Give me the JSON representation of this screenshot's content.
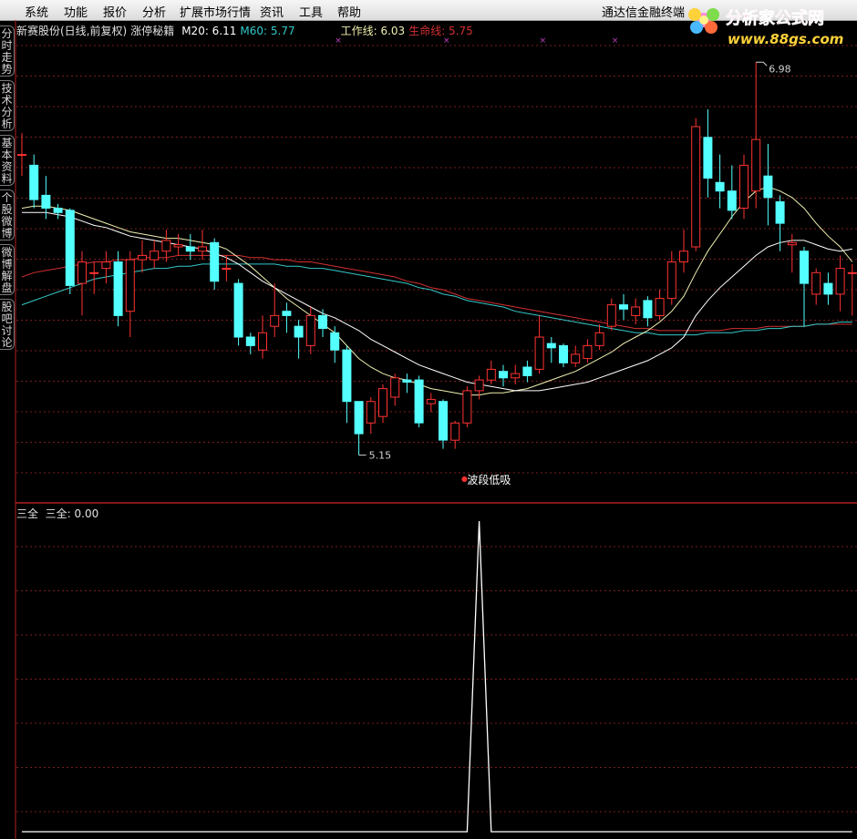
{
  "menu": [
    "系统",
    "功能",
    "报价",
    "分析",
    "扩展市场行情",
    "资讯",
    "工具",
    "帮助"
  ],
  "app_name": "通达信金融终端",
  "logo": {
    "title": "分析家公式网",
    "url": "www.88gs.com"
  },
  "side_tabs": [
    "分时走势",
    "技术分析",
    "基本资料",
    "个股微博",
    "微博解盘",
    "股吧讨论"
  ],
  "main_header": {
    "stock": "新赛股份(日线,前复权)",
    "indicator": "涨停秘籍",
    "m20": "M20: 6.11",
    "m60": "M60: 5.77",
    "work_line": "工作线: 6.03",
    "life_line": "生命线: 5.75"
  },
  "annotations": {
    "high_label": "6.98",
    "low_label": "5.15",
    "signal_label": "波段低吸"
  },
  "sub_header": {
    "name": "三全",
    "value_label": "三全: 0.00"
  },
  "colors": {
    "up": "#ff3232",
    "down": "#54ffff",
    "m20": "#ffffff",
    "m60": "#35c8c8",
    "work": "#f0f0b0",
    "life": "#d23030",
    "grid": "#7a1e1e",
    "signal": "#ffffff"
  },
  "chart_data": [
    {
      "type": "candlestick",
      "title": "新赛股份(日线,前复权)",
      "ylim": [
        5.0,
        7.1
      ],
      "candles": [
        [
          6.55,
          6.55,
          6.65,
          6.45
        ],
        [
          6.5,
          6.34,
          6.55,
          6.3
        ],
        [
          6.36,
          6.3,
          6.45,
          6.25
        ],
        [
          6.3,
          6.28,
          6.32,
          6.25
        ],
        [
          6.29,
          5.94,
          6.3,
          5.9
        ],
        [
          5.95,
          6.05,
          6.1,
          5.8
        ],
        [
          6.0,
          6.0,
          6.05,
          5.9
        ],
        [
          6.02,
          6.05,
          6.1,
          5.95
        ],
        [
          6.05,
          5.8,
          6.1,
          5.75
        ],
        [
          5.82,
          6.06,
          6.1,
          5.7
        ],
        [
          6.06,
          6.08,
          6.15,
          6.0
        ],
        [
          6.06,
          6.1,
          6.15,
          6.02
        ],
        [
          6.1,
          6.15,
          6.2,
          6.05
        ],
        [
          6.12,
          6.13,
          6.18,
          6.08
        ],
        [
          6.12,
          6.1,
          6.18,
          6.06
        ],
        [
          6.1,
          6.12,
          6.2,
          6.06
        ],
        [
          6.14,
          5.96,
          6.16,
          5.92
        ],
        [
          6.02,
          6.02,
          6.08,
          5.96
        ],
        [
          5.95,
          5.7,
          5.97,
          5.66
        ],
        [
          5.7,
          5.66,
          5.72,
          5.62
        ],
        [
          5.64,
          5.72,
          5.8,
          5.6
        ],
        [
          5.75,
          5.8,
          5.95,
          5.7
        ],
        [
          5.82,
          5.8,
          5.86,
          5.72
        ],
        [
          5.75,
          5.7,
          5.78,
          5.6
        ],
        [
          5.66,
          5.8,
          5.84,
          5.62
        ],
        [
          5.8,
          5.74,
          5.83,
          5.7
        ],
        [
          5.72,
          5.64,
          5.75,
          5.58
        ],
        [
          5.64,
          5.4,
          5.66,
          5.3
        ],
        [
          5.4,
          5.25,
          5.4,
          5.15
        ],
        [
          5.3,
          5.4,
          5.42,
          5.25
        ],
        [
          5.33,
          5.46,
          5.48,
          5.3
        ],
        [
          5.42,
          5.51,
          5.53,
          5.38
        ],
        [
          5.5,
          5.49,
          5.53,
          5.44
        ],
        [
          5.5,
          5.3,
          5.52,
          5.28
        ],
        [
          5.39,
          5.41,
          5.44,
          5.35
        ],
        [
          5.4,
          5.22,
          5.41,
          5.18
        ],
        [
          5.22,
          5.3,
          5.31,
          5.18
        ],
        [
          5.3,
          5.45,
          5.47,
          5.28
        ],
        [
          5.45,
          5.5,
          5.52,
          5.41
        ],
        [
          5.5,
          5.55,
          5.59,
          5.48
        ],
        [
          5.54,
          5.51,
          5.57,
          5.47
        ],
        [
          5.51,
          5.53,
          5.57,
          5.48
        ],
        [
          5.56,
          5.52,
          5.59,
          5.49
        ],
        [
          5.55,
          5.7,
          5.8,
          5.53
        ],
        [
          5.67,
          5.65,
          5.7,
          5.58
        ],
        [
          5.66,
          5.58,
          5.67,
          5.56
        ],
        [
          5.58,
          5.62,
          5.66,
          5.56
        ],
        [
          5.6,
          5.66,
          5.69,
          5.58
        ],
        [
          5.66,
          5.72,
          5.76,
          5.64
        ],
        [
          5.75,
          5.85,
          5.88,
          5.73
        ],
        [
          5.85,
          5.83,
          5.9,
          5.78
        ],
        [
          5.8,
          5.84,
          5.88,
          5.76
        ],
        [
          5.87,
          5.79,
          5.89,
          5.75
        ],
        [
          5.8,
          5.88,
          5.92,
          5.78
        ],
        [
          5.88,
          6.05,
          6.1,
          5.85
        ],
        [
          6.05,
          6.1,
          6.2,
          6.0
        ],
        [
          6.12,
          6.68,
          6.72,
          6.1
        ],
        [
          6.63,
          6.44,
          6.76,
          6.35
        ],
        [
          6.42,
          6.38,
          6.55,
          6.3
        ],
        [
          6.38,
          6.29,
          6.5,
          6.25
        ],
        [
          6.3,
          6.5,
          6.55,
          6.25
        ],
        [
          6.38,
          6.62,
          6.98,
          6.3
        ],
        [
          6.45,
          6.35,
          6.6,
          6.22
        ],
        [
          6.33,
          6.23,
          6.36,
          6.1
        ],
        [
          6.13,
          6.14,
          6.18,
          6.0
        ],
        [
          6.1,
          5.95,
          6.12,
          5.75
        ],
        [
          5.9,
          6.0,
          6.02,
          5.85
        ],
        [
          5.95,
          5.9,
          6.0,
          5.85
        ],
        [
          5.9,
          6.02,
          6.08,
          5.82
        ],
        [
          6.0,
          6.0,
          6.04,
          5.8
        ]
      ],
      "m20": [
        6.28,
        6.28,
        6.28,
        6.27,
        6.26,
        6.24,
        6.22,
        6.21,
        6.19,
        6.17,
        6.16,
        6.15,
        6.14,
        6.13,
        6.12,
        6.11,
        6.09,
        6.07,
        6.04,
        6.0,
        5.96,
        5.93,
        5.9,
        5.87,
        5.84,
        5.81,
        5.79,
        5.76,
        5.73,
        5.69,
        5.66,
        5.63,
        5.6,
        5.57,
        5.55,
        5.53,
        5.51,
        5.49,
        5.48,
        5.47,
        5.46,
        5.45,
        5.45,
        5.45,
        5.46,
        5.47,
        5.48,
        5.49,
        5.51,
        5.53,
        5.55,
        5.57,
        5.59,
        5.62,
        5.65,
        5.7,
        5.8,
        5.87,
        5.93,
        5.98,
        6.03,
        6.08,
        6.12,
        6.14,
        6.15,
        6.15,
        6.13,
        6.11,
        6.1,
        6.11
      ],
      "m60": [
        5.85,
        5.87,
        5.89,
        5.91,
        5.93,
        5.95,
        5.97,
        5.98,
        5.99,
        6.0,
        6.01,
        6.02,
        6.02,
        6.03,
        6.03,
        6.04,
        6.04,
        6.04,
        6.04,
        6.04,
        6.04,
        6.04,
        6.03,
        6.03,
        6.02,
        6.02,
        6.01,
        6.0,
        5.99,
        5.98,
        5.97,
        5.96,
        5.95,
        5.93,
        5.92,
        5.9,
        5.89,
        5.87,
        5.86,
        5.85,
        5.84,
        5.82,
        5.81,
        5.8,
        5.79,
        5.78,
        5.77,
        5.76,
        5.75,
        5.74,
        5.73,
        5.72,
        5.72,
        5.71,
        5.71,
        5.71,
        5.71,
        5.72,
        5.72,
        5.72,
        5.73,
        5.73,
        5.74,
        5.74,
        5.75,
        5.75,
        5.76,
        5.76,
        5.77,
        5.77
      ],
      "work_line": [
        6.3,
        6.31,
        6.31,
        6.3,
        6.29,
        6.27,
        6.25,
        6.23,
        6.21,
        6.19,
        6.18,
        6.17,
        6.16,
        6.16,
        6.15,
        6.14,
        6.13,
        6.11,
        6.07,
        6.03,
        5.98,
        5.93,
        5.88,
        5.84,
        5.8,
        5.76,
        5.72,
        5.66,
        5.6,
        5.56,
        5.53,
        5.51,
        5.5,
        5.48,
        5.46,
        5.45,
        5.44,
        5.43,
        5.43,
        5.44,
        5.44,
        5.45,
        5.46,
        5.48,
        5.5,
        5.52,
        5.54,
        5.57,
        5.6,
        5.63,
        5.67,
        5.7,
        5.73,
        5.77,
        5.82,
        5.89,
        6.0,
        6.1,
        6.18,
        6.26,
        6.33,
        6.38,
        6.4,
        6.38,
        6.35,
        6.3,
        6.23,
        6.17,
        6.12,
        6.05
      ],
      "life_line": [
        5.98,
        6.0,
        6.01,
        6.02,
        6.03,
        6.04,
        6.05,
        6.05,
        6.06,
        6.06,
        6.07,
        6.07,
        6.07,
        6.08,
        6.08,
        6.08,
        6.08,
        6.08,
        6.08,
        6.07,
        6.07,
        6.06,
        6.06,
        6.05,
        6.05,
        6.04,
        6.03,
        6.02,
        6.01,
        6.0,
        5.99,
        5.98,
        5.96,
        5.95,
        5.93,
        5.92,
        5.9,
        5.88,
        5.87,
        5.86,
        5.85,
        5.84,
        5.83,
        5.82,
        5.81,
        5.8,
        5.79,
        5.78,
        5.77,
        5.76,
        5.75,
        5.74,
        5.74,
        5.73,
        5.73,
        5.73,
        5.73,
        5.73,
        5.73,
        5.74,
        5.74,
        5.74,
        5.75,
        5.75,
        5.75,
        5.75,
        5.76,
        5.76,
        5.76,
        5.76
      ],
      "signal_index": 37,
      "high_index": 61,
      "low_index": 28
    },
    {
      "type": "line",
      "title": "三全",
      "ylim": [
        0,
        1
      ],
      "values": [
        0,
        0,
        0,
        0,
        0,
        0,
        0,
        0,
        0,
        0,
        0,
        0,
        0,
        0,
        0,
        0,
        0,
        0,
        0,
        0,
        0,
        0,
        0,
        0,
        0,
        0,
        0,
        0,
        0,
        0,
        0,
        0,
        0,
        0,
        0,
        0,
        0,
        0,
        1,
        0,
        0,
        0,
        0,
        0,
        0,
        0,
        0,
        0,
        0,
        0,
        0,
        0,
        0,
        0,
        0,
        0,
        0,
        0,
        0,
        0,
        0,
        0,
        0,
        0,
        0,
        0,
        0,
        0,
        0,
        0
      ]
    }
  ]
}
